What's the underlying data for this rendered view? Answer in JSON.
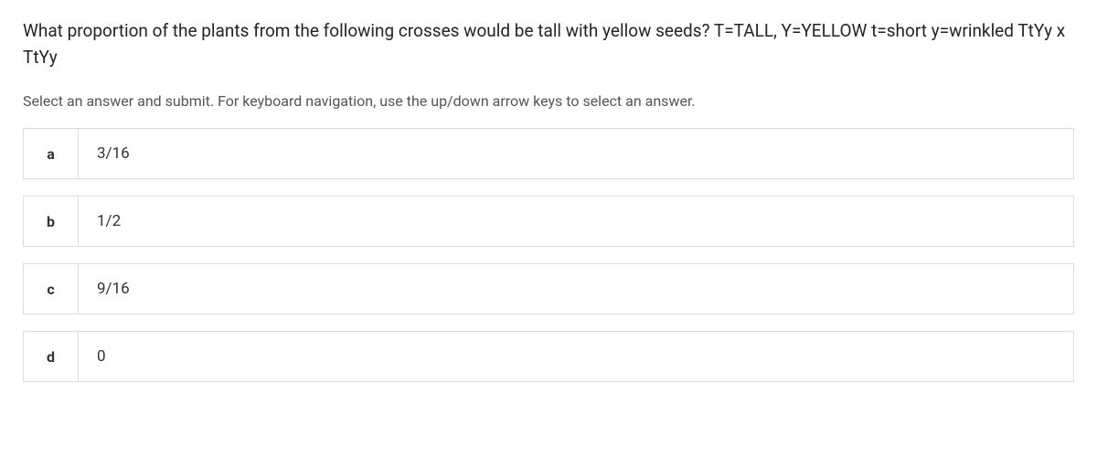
{
  "question": {
    "text": "What proportion of the plants from the following crosses would be tall with yellow seeds? T=TALL, Y=YELLOW t=short y=wrinkled TtYy x TtYy"
  },
  "instruction": "Select an answer and submit. For keyboard navigation, use the up/down arrow keys to select an answer.",
  "options": [
    {
      "letter": "a",
      "text": "3/16"
    },
    {
      "letter": "b",
      "text": "1/2"
    },
    {
      "letter": "c",
      "text": "9/16"
    },
    {
      "letter": "d",
      "text": "0"
    }
  ]
}
